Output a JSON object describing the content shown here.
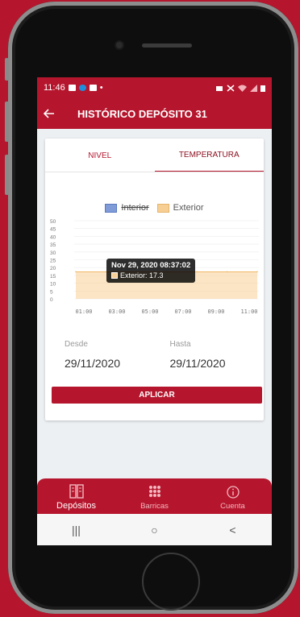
{
  "status_bar": {
    "time": "11:46",
    "dot": "•"
  },
  "app_bar": {
    "back_icon": "arrow-left-icon",
    "title": "HISTÓRICO DEPÓSITO 31"
  },
  "tabs": [
    {
      "label": "NIVEL",
      "active": false
    },
    {
      "label": "TEMPERATURA",
      "active": true
    }
  ],
  "colors": {
    "brand": "#b5162d",
    "interior": "#7f9cd8",
    "exterior": "#f7cf95"
  },
  "chart_data": {
    "type": "area",
    "legend": [
      {
        "name": "Interior",
        "hidden": true
      },
      {
        "name": "Exterior",
        "hidden": false
      }
    ],
    "x": [
      "01:00",
      "03:00",
      "05:00",
      "07:00",
      "09:00",
      "11:00"
    ],
    "y_ticks": [
      0,
      5,
      10,
      15,
      20,
      25,
      30,
      35,
      40,
      45,
      50
    ],
    "ylim": [
      0,
      50
    ],
    "series": [
      {
        "name": "Exterior",
        "values": [
          17.3,
          17.3,
          17.3,
          17.3,
          17.3,
          17.3,
          17.3
        ]
      }
    ],
    "tooltip": {
      "title": "Nov 29, 2020 08:37:02",
      "series": "Exterior",
      "value": 17.3,
      "label": "Exterior: 17.3"
    }
  },
  "filters": {
    "from_label": "Desde",
    "from_value": "29/11/2020",
    "to_label": "Hasta",
    "to_value": "29/11/2020",
    "apply_label": "APLICAR"
  },
  "bottom_nav": [
    {
      "label": "Depósitos",
      "icon": "barrels-icon",
      "active": true
    },
    {
      "label": "Barricas",
      "icon": "barrel-grid-icon",
      "active": false
    },
    {
      "label": "Cuenta",
      "icon": "info-icon",
      "active": false
    }
  ],
  "system_nav": {
    "recents": "|||",
    "home": "○",
    "back": "<"
  }
}
